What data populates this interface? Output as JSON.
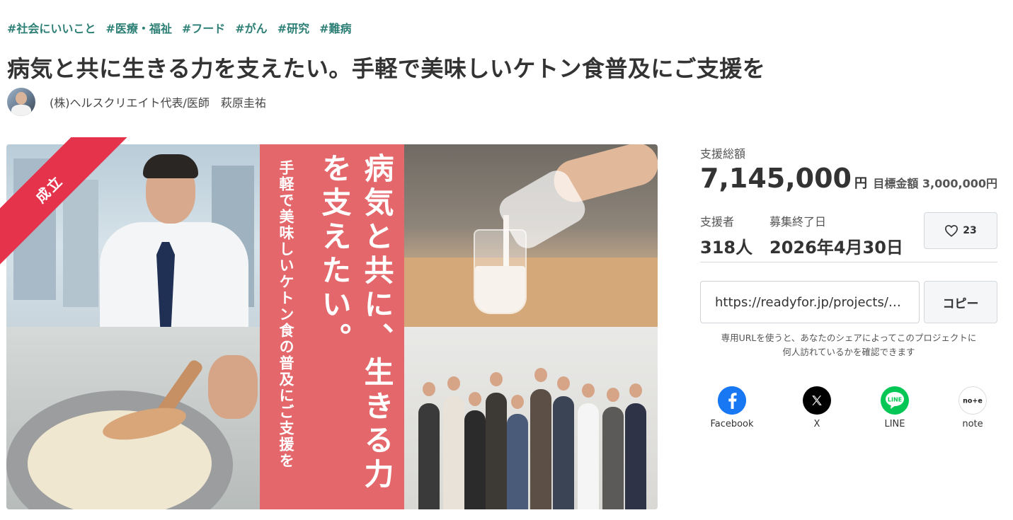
{
  "tags": [
    "#社会にいいこと",
    "#医療・福祉",
    "#フード",
    "#がん",
    "#研究",
    "#難病"
  ],
  "title": "病気と共に生きる力を支えたい。手軽で美味しいケトン食普及にご支援を",
  "owner": {
    "name": "(株)ヘルスクリエイト代表/医師　萩原圭祐"
  },
  "hero": {
    "ribbon": "成立",
    "vertical_small": "手軽で美味しいケトン食の普及にご支援を",
    "vertical_big": "病気と共に、生きる力を支えたい。"
  },
  "funding": {
    "total_label": "支援総額",
    "total_amount": "7,145,000",
    "currency": "円",
    "goal_text": "目標金額 3,000,000円",
    "supporters_label": "支援者",
    "supporters_value": "318人",
    "end_label": "募集終了日",
    "end_value": "2026年4月30日",
    "favorite_count": "23"
  },
  "share_url": {
    "value": "https://readyfor.jp/projects/…",
    "copy_label": "コピー",
    "hint": "専用URLを使うと、あなたのシェアによってこのプロジェクトに何人訪れているかを確認できます"
  },
  "share": [
    {
      "label": "Facebook",
      "icon": "facebook-icon",
      "color": "#1877f2"
    },
    {
      "label": "X",
      "icon": "x-icon",
      "color": "#000000"
    },
    {
      "label": "LINE",
      "icon": "line-icon",
      "color": "#06c755"
    },
    {
      "label": "note",
      "icon": "note-icon",
      "color": "#ffffff"
    }
  ],
  "colors": {
    "tag": "#2e8076",
    "ribbon": "#e5334b",
    "hero_panel": "#e4676b"
  }
}
